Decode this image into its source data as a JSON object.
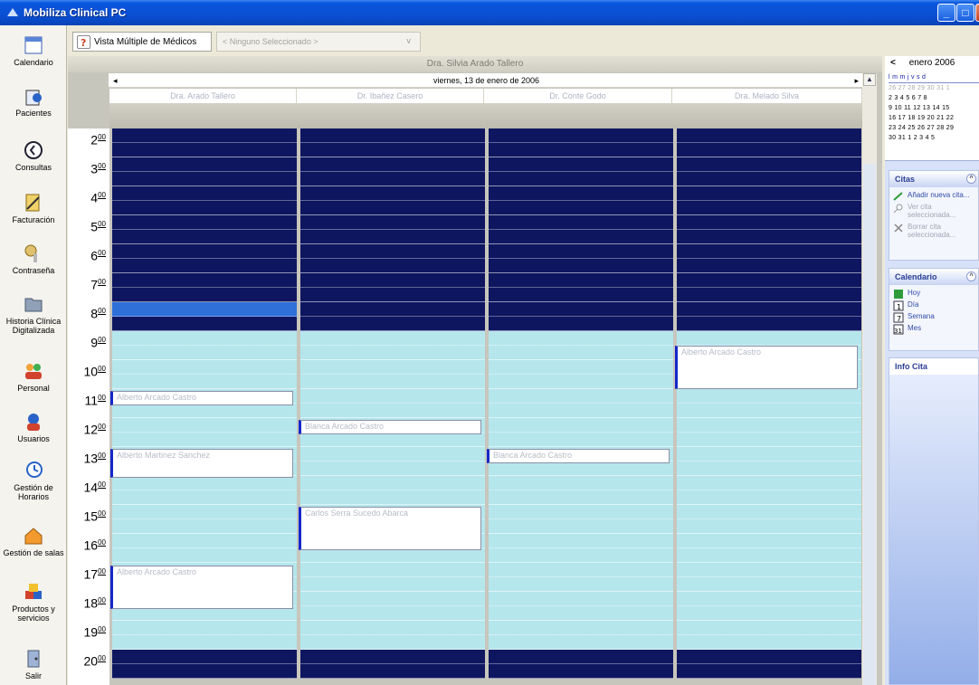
{
  "window": {
    "title": "Mobiliza Clinical PC"
  },
  "nav": [
    {
      "label": "Calendario",
      "icon": "calendar-icon"
    },
    {
      "label": "Pacientes",
      "icon": "patients-icon"
    },
    {
      "label": "Consultas",
      "icon": "clock-icon"
    },
    {
      "label": "Facturación",
      "icon": "billing-icon"
    },
    {
      "label": "Contraseña",
      "icon": "key-icon"
    },
    {
      "label": "Historia Clínica Digitalizada",
      "icon": "folder-icon"
    },
    {
      "label": "Personal",
      "icon": "staff-icon"
    },
    {
      "label": "Usuarios",
      "icon": "users-icon"
    },
    {
      "label": "Gestión de Horarios",
      "icon": "schedule-icon"
    },
    {
      "label": "Gestión de salas",
      "icon": "rooms-icon"
    },
    {
      "label": "Productos y servicios",
      "icon": "products-icon"
    },
    {
      "label": "Salir",
      "icon": "exit-icon"
    }
  ],
  "toolbar": {
    "multi_view_label": "Vista Múltiple de Médicos",
    "select_value": "< Ninguno Seleccionado >"
  },
  "calendar": {
    "header_title": "Dra. Silvia Arado Tallero",
    "date_label": "viernes, 13 de enero de 2006",
    "columns": [
      "Dra. Arado Tallero",
      "Dr. Ibañez Casero",
      "Dr. Conte Godo",
      "Dra. Melado Silva"
    ],
    "hours": [
      "2",
      "3",
      "4",
      "5",
      "6",
      "7",
      "8",
      "9",
      "10",
      "11",
      "12",
      "13",
      "14",
      "15",
      "16",
      "17",
      "18",
      "19",
      "20"
    ],
    "minutes": "00",
    "appointments": [
      {
        "col": 0,
        "text": "Alberto Arcado Castro"
      },
      {
        "col": 0,
        "text": "Alberto Martinez Sanchez"
      },
      {
        "col": 0,
        "text": "Alberto Arcado Castro"
      },
      {
        "col": 1,
        "text": "Blanca Arcado Castro"
      },
      {
        "col": 1,
        "text": "Carlos Serra Sucedo Abarca"
      },
      {
        "col": 2,
        "text": "Blanca Arcado Castro"
      },
      {
        "col": 3,
        "text": "Alberto Arcado Castro"
      }
    ]
  },
  "minical": {
    "month": "enero 2006",
    "nav_prev": "<",
    "weekdays": "l  m  m  j  v  s  d",
    "rows": [
      "26 27 28 29 30 31  1",
      "2  3  4  5  6  7  8",
      "9 10 11 12 13 14 15",
      "16 17 18 19 20 21 22",
      "23 24 25 26 27 28 29",
      "30 31  1  2  3  4  5"
    ]
  },
  "panels": {
    "citas_title": "Citas",
    "citas_items": [
      "Añadir nueva cita...",
      "Ver cita seleccionada...",
      "Borrar cita seleccionada..."
    ],
    "calendario_title": "Calendario",
    "calendario_items": [
      "Hoy",
      "Día",
      "Semana",
      "Mes"
    ],
    "info_title": "Info Cita"
  },
  "colors": {
    "night": "#0f1660",
    "day": "#b5e6ec",
    "accent": "#1428c9"
  }
}
